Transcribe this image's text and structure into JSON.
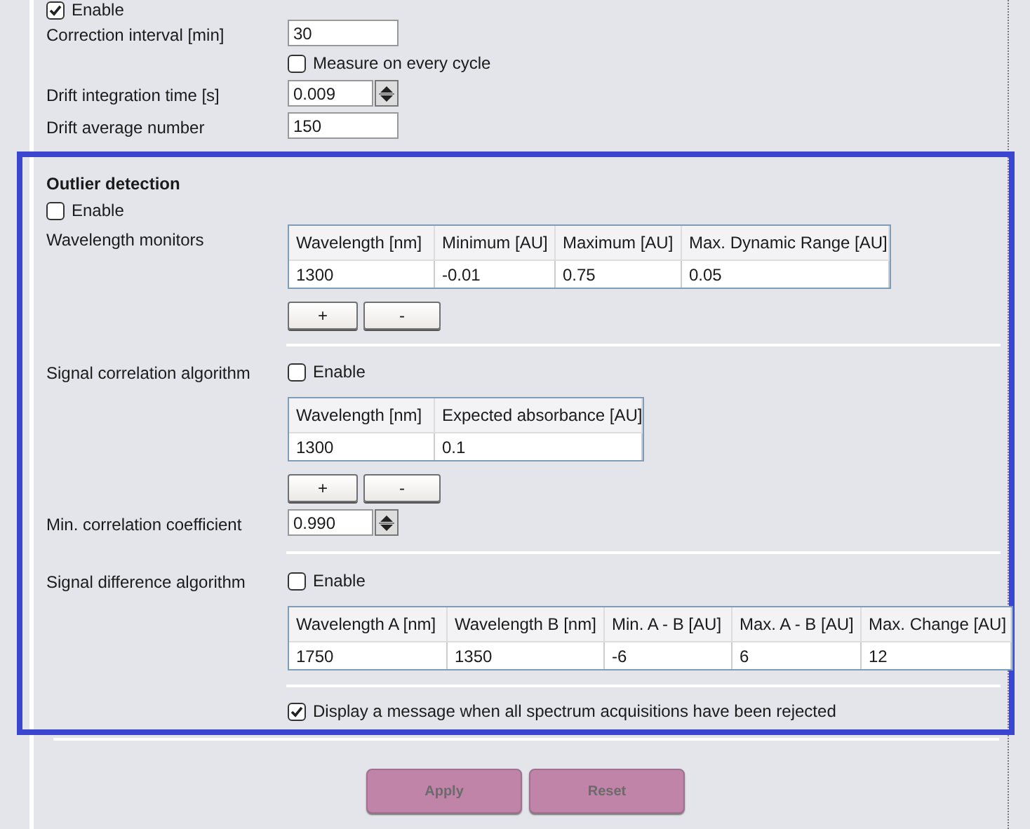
{
  "drift_correction": {
    "enable": {
      "label": "Enable",
      "checked": true
    },
    "correction_interval": {
      "label": "Correction interval [min]",
      "value": "30"
    },
    "measure_every_cycle": {
      "label": "Measure on every cycle",
      "checked": false
    },
    "integration_time": {
      "label": "Drift integration time [s]",
      "value": "0.009"
    },
    "average_number": {
      "label": "Drift average number",
      "value": "150"
    }
  },
  "outlier_detection": {
    "title": "Outlier detection",
    "enable": {
      "label": "Enable",
      "checked": false
    },
    "wavelength_monitors": {
      "label": "Wavelength monitors",
      "columns": [
        "Wavelength [nm]",
        "Minimum [AU]",
        "Maximum [AU]",
        "Max. Dynamic Range [AU]"
      ],
      "rows": [
        [
          "1300",
          "-0.01",
          "0.75",
          "0.05"
        ]
      ],
      "buttons": [
        "+",
        "-"
      ]
    },
    "signal_correlation": {
      "label": "Signal correlation algorithm",
      "enable": {
        "label": "Enable",
        "checked": false
      },
      "columns": [
        "Wavelength [nm]",
        "Expected absorbance [AU]"
      ],
      "rows": [
        [
          "1300",
          "0.1"
        ]
      ],
      "buttons": [
        "+",
        "-"
      ],
      "min_coefficient": {
        "label": "Min. correlation coefficient",
        "value": "0.990"
      }
    },
    "signal_difference": {
      "label": "Signal difference algorithm",
      "enable": {
        "label": "Enable",
        "checked": false
      },
      "columns": [
        "Wavelength A [nm]",
        "Wavelength B [nm]",
        "Min. A - B [AU]",
        "Max. A - B [AU]",
        "Max. Change [AU]"
      ],
      "rows": [
        [
          "1750",
          "1350",
          "-6",
          "6",
          "12"
        ]
      ]
    },
    "display_message": {
      "label": "Display a message when all spectrum acquisitions have been rejected",
      "checked": true
    }
  },
  "actions": [
    {
      "label": "Apply",
      "disabled": true
    },
    {
      "label": "Reset",
      "disabled": true
    }
  ]
}
